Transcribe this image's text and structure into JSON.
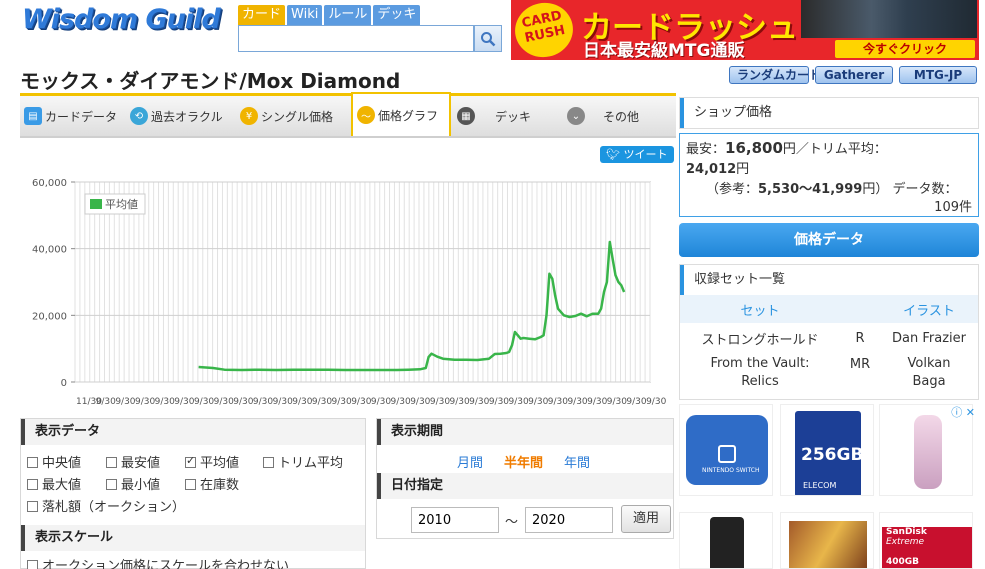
{
  "header": {
    "logo_text": "Wisdom Guild",
    "search_tabs": [
      "カード",
      "Wiki",
      "ルール",
      "デッキ"
    ],
    "search_placeholder": ""
  },
  "banner": {
    "logo_text": "CARD RUSH",
    "title": "カードラッシュ",
    "subtitle": "日本最安級MTG通販",
    "click": "今すぐクリック"
  },
  "page": {
    "title": "モックス・ダイアモンド/Mox Diamond",
    "header_buttons": [
      "ランダムカード",
      "Gatherer",
      "MTG-JP"
    ]
  },
  "tabs": [
    {
      "label": "カードデータ",
      "icon": "card-icon",
      "color": "#3a9be6"
    },
    {
      "label": "過去オラクル",
      "icon": "history-icon",
      "color": "#3aa6d8"
    },
    {
      "label": "シングル価格",
      "icon": "yen-icon",
      "color": "#f0b400"
    },
    {
      "label": "価格グラフ",
      "icon": "graph-icon",
      "color": "#f0b400"
    },
    {
      "label": "デッキ",
      "icon": "deck-icon",
      "color": "#666"
    },
    {
      "label": "その他",
      "icon": "chevron-down-icon",
      "color": "#888"
    }
  ],
  "tweet_label": "ツイート",
  "chart_data": {
    "type": "line",
    "legend": "平均値",
    "legend_placement": "top-left",
    "ylim": [
      0,
      60000
    ],
    "y_ticks": [
      "0",
      "20,000",
      "40,000",
      "60,000"
    ],
    "x_ticks": [
      "11/30",
      "9/30",
      "9/30",
      "9/30",
      "9/30",
      "9/30",
      "9/30",
      "9/30",
      "9/30",
      "9/30",
      "9/30",
      "9/30",
      "9/30",
      "9/30",
      "9/30",
      "9/30",
      "9/30",
      "9/30",
      "9/30",
      "9/30",
      "9/30",
      "9/30",
      "9/30",
      "9/30",
      "9/30",
      "9/30",
      "9/30",
      "9/30",
      "9/30",
      "9/30",
      "9/30",
      "9/30",
      "9/30",
      "9/30",
      "9/30",
      "9/30",
      "9/30",
      "9/30",
      "9/30",
      "9/30",
      "9/30",
      "9/30",
      "9/30",
      "9/30",
      "9/30",
      "9/30",
      "9/30",
      "9/30",
      "9/30",
      "9/30",
      "9/30",
      "9/30",
      "9/30",
      "9/30",
      "9/30",
      "9/30",
      "9/30",
      "9/30",
      "9/30",
      "9/30",
      "9/30",
      "9/30",
      "9/30",
      "9/30",
      "9/30",
      "9/30",
      "9/30",
      "9/30",
      "9/30",
      "9/30",
      "9/30",
      "9/30",
      "9/30",
      "9/30",
      "9/30",
      "9/30",
      "9/30",
      "9/30",
      "9/30",
      "9/30",
      "9/30",
      "9/30",
      "9/30",
      "9/30",
      "9/30",
      "9/30",
      "9/30",
      "9/30",
      "9/30",
      "9/30",
      "9/30",
      "9/30",
      "9/30",
      "9/30",
      "9/30",
      "9/30",
      "9/30",
      "9/30",
      "9/30",
      "9/30",
      "9/30",
      "9/30",
      "9/30",
      "9/30",
      "9/30",
      "9/30",
      "9/30",
      "9/30",
      "9/30",
      "9/30",
      "9/30",
      "9/30",
      "9/30",
      "9/30",
      "9/30",
      "9/30",
      "9/30",
      "9/30"
    ],
    "grid": true,
    "line_color": "#39b54a",
    "series": [
      {
        "name": "平均値",
        "points": [
          [
            0.215,
            4500
          ],
          [
            0.24,
            4200
          ],
          [
            0.26,
            3700
          ],
          [
            0.29,
            3600
          ],
          [
            0.32,
            3700
          ],
          [
            0.35,
            3600
          ],
          [
            0.38,
            3700
          ],
          [
            0.41,
            3700
          ],
          [
            0.44,
            3700
          ],
          [
            0.47,
            3600
          ],
          [
            0.5,
            3600
          ],
          [
            0.53,
            3600
          ],
          [
            0.56,
            3600
          ],
          [
            0.58,
            3700
          ],
          [
            0.6,
            3800
          ],
          [
            0.61,
            4200
          ],
          [
            0.615,
            7500
          ],
          [
            0.62,
            8500
          ],
          [
            0.63,
            7600
          ],
          [
            0.64,
            7000
          ],
          [
            0.66,
            6700
          ],
          [
            0.68,
            6700
          ],
          [
            0.7,
            6600
          ],
          [
            0.72,
            7000
          ],
          [
            0.73,
            8400
          ],
          [
            0.74,
            8500
          ],
          [
            0.75,
            8700
          ],
          [
            0.755,
            9000
          ],
          [
            0.76,
            11000
          ],
          [
            0.765,
            15000
          ],
          [
            0.77,
            14000
          ],
          [
            0.775,
            13000
          ],
          [
            0.78,
            13200
          ],
          [
            0.79,
            13000
          ],
          [
            0.8,
            12800
          ],
          [
            0.81,
            13500
          ],
          [
            0.815,
            14000
          ],
          [
            0.82,
            20000
          ],
          [
            0.825,
            32500
          ],
          [
            0.83,
            31000
          ],
          [
            0.835,
            26000
          ],
          [
            0.84,
            22000
          ],
          [
            0.85,
            20000
          ],
          [
            0.86,
            19500
          ],
          [
            0.87,
            19800
          ],
          [
            0.88,
            20500
          ],
          [
            0.89,
            19700
          ],
          [
            0.9,
            20500
          ],
          [
            0.91,
            20500
          ],
          [
            0.915,
            22000
          ],
          [
            0.92,
            27000
          ],
          [
            0.925,
            30000
          ],
          [
            0.93,
            42000
          ],
          [
            0.935,
            37000
          ],
          [
            0.94,
            32000
          ],
          [
            0.945,
            30000
          ],
          [
            0.95,
            29000
          ],
          [
            0.955,
            27000
          ]
        ]
      }
    ]
  },
  "display_data": {
    "title": "表示データ",
    "options": [
      {
        "label": "中央値",
        "checked": false
      },
      {
        "label": "最安値",
        "checked": false
      },
      {
        "label": "平均値",
        "checked": true
      },
      {
        "label": "トリム平均",
        "checked": false
      },
      {
        "label": "最大値",
        "checked": false
      },
      {
        "label": "最小値",
        "checked": false
      },
      {
        "label": "在庫数",
        "checked": false
      },
      {
        "label": "落札額（オークション）",
        "checked": false
      }
    ],
    "scale_title": "表示スケール",
    "scale_option": "オークション価格にスケールを合わせない"
  },
  "period": {
    "title": "表示期間",
    "links": [
      "月間",
      "半年間",
      "年間"
    ],
    "active": "半年間",
    "date_title": "日付指定",
    "from": "2010",
    "sep": "〜",
    "to": "2020",
    "apply": "適用"
  },
  "shop": {
    "title": "ショップ価格",
    "min_label": "最安：",
    "min_value": "16,800",
    "yen": "円",
    "trim_label": "／トリム平均：",
    "trim_value": "24,012",
    "ref_label": "（参考：",
    "ref_value": "5,530〜41,999",
    "ref_end": "円）",
    "count_label": "データ数：",
    "count_value": "109件",
    "data_button": "価格データ"
  },
  "sets": {
    "title": "収録セット一覧",
    "headers": [
      "セット",
      "イラスト"
    ],
    "rows": [
      {
        "set": "ストロングホールド",
        "rarity": "R",
        "artist": "Dan Frazier"
      },
      {
        "set": "From the Vault: Relics",
        "rarity": "MR",
        "artist": "Volkan Baga"
      }
    ]
  },
  "ads": {
    "sd_label": "256GB",
    "sd_brand": "ELECOM",
    "sandisk_brand": "SanDisk",
    "sandisk_model": "Extreme",
    "sandisk_size": "400GB",
    "switch_label": "NINTENDO SWITCH"
  }
}
